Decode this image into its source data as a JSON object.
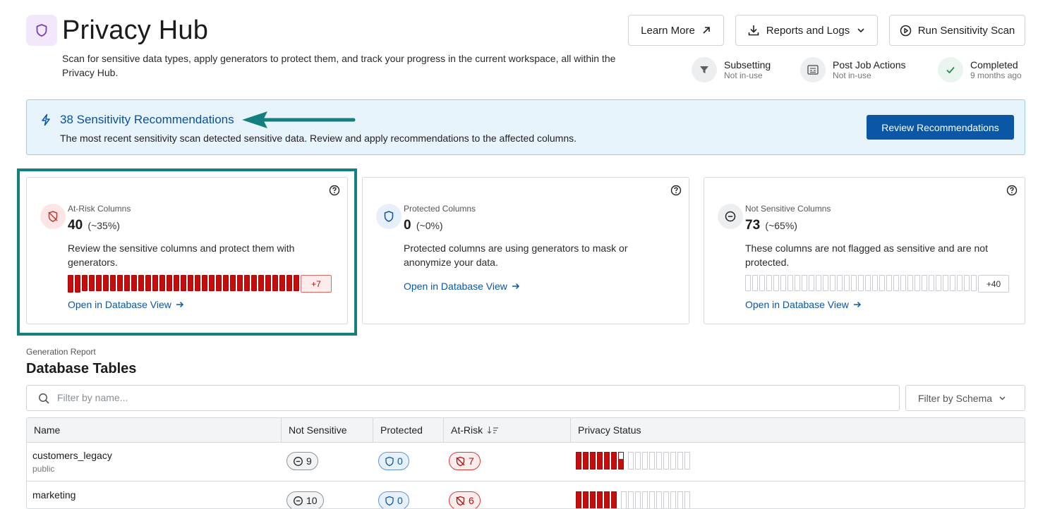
{
  "header": {
    "title": "Privacy Hub",
    "description": "Scan for sensitive data types, apply generators to protect them, and track your progress in the current workspace, all within the Privacy Hub.",
    "buttons": {
      "learn_more": "Learn More",
      "reports_logs": "Reports and Logs",
      "run_scan": "Run Sensitivity Scan"
    },
    "status": [
      {
        "label": "Subsetting",
        "sub": "Not in-use",
        "icon": "filter-icon"
      },
      {
        "label": "Post Job Actions",
        "sub": "Not in-use",
        "icon": "post-job-icon"
      },
      {
        "label": "Completed",
        "sub": "9 months ago",
        "icon": "check-icon"
      }
    ]
  },
  "banner": {
    "title": "38 Sensitivity Recommendations",
    "text": "The most recent sensitivity scan detected sensitive data. Review and apply recommendations to the affected columns.",
    "button": "Review Recommendations"
  },
  "cards": {
    "at_risk": {
      "label": "At-Risk Columns",
      "count": "40",
      "percent": "(~35%)",
      "description": "Review the sensitive columns and protect them with generators.",
      "overflow": "+7",
      "link": "Open in Database View"
    },
    "protected": {
      "label": "Protected Columns",
      "count": "0",
      "percent": "(~0%)",
      "description": "Protected columns are using generators to mask or anonymize your data.",
      "link": "Open in Database View"
    },
    "not_sensitive": {
      "label": "Not Sensitive Columns",
      "count": "73",
      "percent": "(~65%)",
      "description": "These columns are not flagged as sensitive and are not protected.",
      "overflow": "+40",
      "link": "Open in Database View"
    }
  },
  "report": {
    "section_label": "Generation Report",
    "title": "Database Tables",
    "search_placeholder": "Filter by name...",
    "filter_label": "Filter by Schema",
    "columns": [
      "Name",
      "Not Sensitive",
      "Protected",
      "At-Risk",
      "Privacy Status"
    ],
    "rows": [
      {
        "name": "customers_legacy",
        "schema": "public",
        "not_sensitive": "9",
        "protected": "0",
        "at_risk": "7"
      },
      {
        "name": "marketing",
        "schema": "",
        "not_sensitive": "10",
        "protected": "0",
        "at_risk": "6"
      }
    ]
  },
  "colors": {
    "accent": "#0b56a5",
    "risk": "#c40e0e",
    "highlight": "#137f7f"
  }
}
